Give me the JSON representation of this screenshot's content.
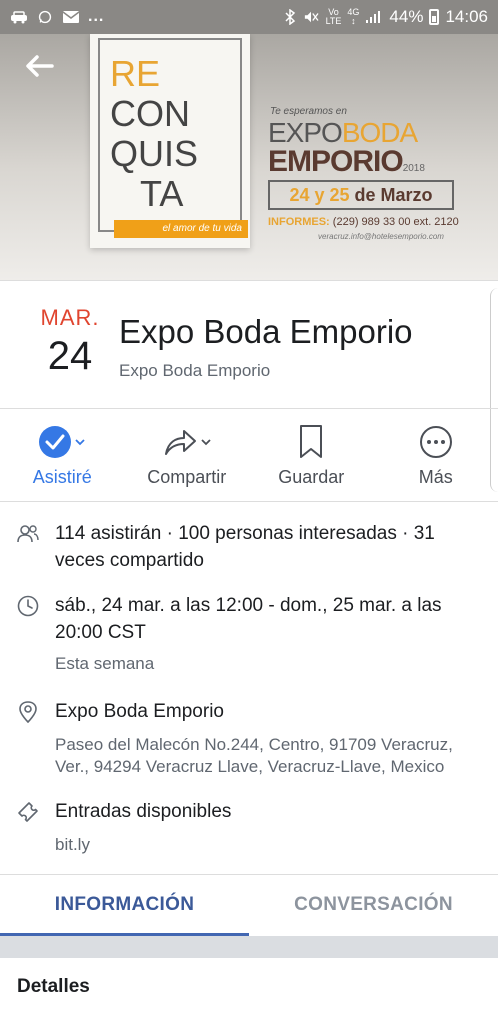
{
  "status_bar": {
    "dots": "...",
    "network_top": "Vo",
    "network_bottom": "LTE",
    "net_type_top": "4G",
    "net_type_bottom": "↕",
    "battery": "44%",
    "time": "14:06"
  },
  "cover": {
    "reconquista_lines": [
      "RE",
      "CON",
      "QUIS",
      "TA"
    ],
    "tagline": "el amor de tu vida",
    "intro": "Te esperamos en",
    "brand_line1_a": "EXPO",
    "brand_line1_b": "BODA",
    "brand_line2": "EMPORIO",
    "brand_year": "2018",
    "dates_num": "24 y 25",
    "dates_rest": " de Marzo",
    "informes_label": "INFORMES:",
    "informes_phone": "(229) 989 33 00 ext. 2120",
    "email": "veracruz.info@hotelesemporio.com"
  },
  "header": {
    "month": "MAR.",
    "day": "24",
    "title": "Expo Boda Emporio",
    "host": "Expo Boda Emporio"
  },
  "actions": [
    {
      "label": "Asistiré"
    },
    {
      "label": "Compartir"
    },
    {
      "label": "Guardar"
    },
    {
      "label": "Más"
    }
  ],
  "details": {
    "attendance": "114 asistirán · 100 personas interesadas · 31 veces compartido",
    "datetime": "sáb., 24 mar. a las 12:00 - dom., 25 mar. a las 20:00 CST",
    "datetime_sub": "Esta semana",
    "location": "Expo Boda Emporio",
    "address": "Paseo del Malecón No.244, Centro, 91709 Veracruz, Ver., 94294 Veracruz Llave, Veracruz-Llave, Mexico",
    "tickets": "Entradas disponibles",
    "tickets_link": "bit.ly"
  },
  "tabs": [
    {
      "label": "INFORMACIÓN"
    },
    {
      "label": "CONVERSACIÓN"
    }
  ],
  "section": {
    "title": "Detalles"
  },
  "colors": {
    "accent_blue": "#3578e5",
    "date_red": "#e0452f",
    "tab_blue": "#3b5998",
    "cover_orange": "#e8a533"
  }
}
